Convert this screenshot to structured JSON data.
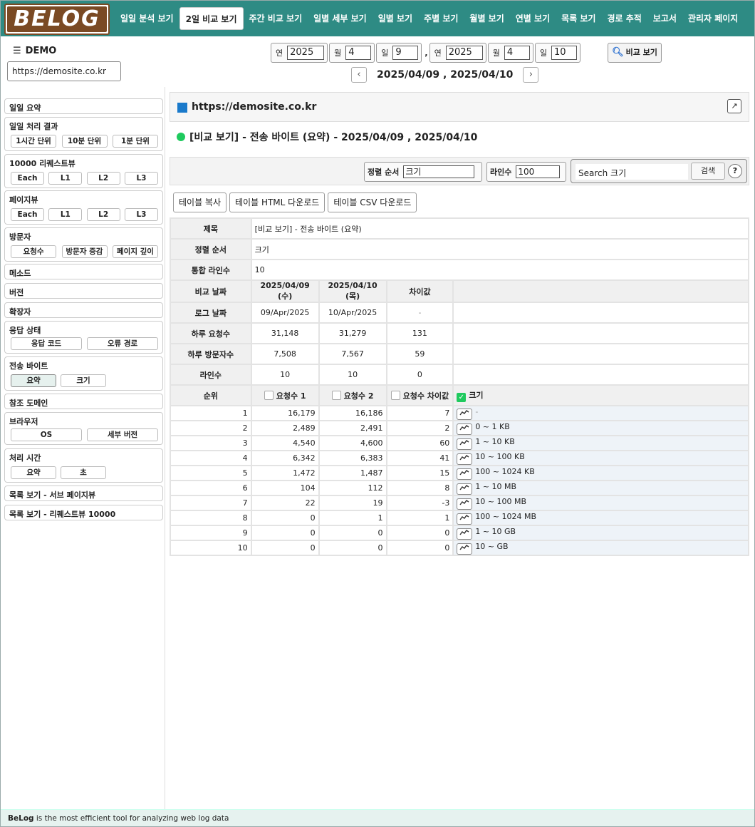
{
  "brand": {
    "logo_text": "BELOG"
  },
  "nav": [
    "일일 분석 보기",
    "2일 비교 보기",
    "주간 비교 보기",
    "일별 세부 보기",
    "일별 보기",
    "주별 보기",
    "월별 보기",
    "연별 보기",
    "목록 보기",
    "경로 추적",
    "보고서",
    "관리자 페이지"
  ],
  "header": {
    "site_name": "DEMO",
    "site_url": "https://demosite.co.kr",
    "date_labels": {
      "year": "연",
      "month": "월",
      "day": "일"
    },
    "date1": {
      "year": "2025",
      "month": "4",
      "day": "9"
    },
    "date2": {
      "year": "2025",
      "month": "4",
      "day": "10"
    },
    "compare_button": "비교 보기",
    "range_text": "2025/04/09 , 2025/04/10"
  },
  "sidebar": {
    "daily_summary": "일일 요약",
    "daily_process": {
      "title": "일일 처리 결과",
      "buttons": [
        "1시간 단위",
        "10분 단위",
        "1분 단위"
      ]
    },
    "requests": {
      "title": "10000 리퀘스트뷰",
      "buttons": [
        "Each",
        "L1",
        "L2",
        "L3"
      ]
    },
    "pageviews": {
      "title": "페이지뷰",
      "buttons": [
        "Each",
        "L1",
        "L2",
        "L3"
      ]
    },
    "visitors": {
      "title": "방문자",
      "buttons": [
        "요청수",
        "방문자 증감",
        "페이지 깊이"
      ]
    },
    "method": "메소드",
    "version": "버전",
    "extension": "확장자",
    "status": {
      "title": "응답 상태",
      "buttons": [
        "응답 코드",
        "오류 경로"
      ]
    },
    "bytes": {
      "title": "전송 바이트",
      "buttons": [
        "요약",
        "크기"
      ]
    },
    "referer": "참조 도메인",
    "browser": {
      "title": "브라우저",
      "buttons": [
        "OS",
        "세부 버전"
      ]
    },
    "ptime": {
      "title": "처리 시간",
      "buttons": [
        "요약",
        "초"
      ]
    },
    "list_sub": "목록 보기 - 서브 페이지뷰",
    "list_req": "목록 보기 - 리퀘스트뷰 10000"
  },
  "main": {
    "site_title": "https://demosite.co.kr",
    "report_title": "[비교 보기] - 전송 바이트 (요약) - 2025/04/09 , 2025/04/10",
    "sort_label": "정렬 순서",
    "sort_value": "크기",
    "lines_label": "라인수",
    "lines_value": "100",
    "search_placeholder": "Search 크기",
    "search_button": "검색",
    "help": "?",
    "actions": [
      "테이블 복사",
      "테이블 HTML 다운로드",
      "테이블 CSV 다운로드"
    ]
  },
  "table": {
    "meta": [
      {
        "label": "제목",
        "value": "[비교 보기] - 전송 바이트 (요약)"
      },
      {
        "label": "정렬 순서",
        "value": "크기"
      },
      {
        "label": "통합 라인수",
        "value": "10"
      }
    ],
    "compare_header": {
      "label": "비교 날짜",
      "d1": "2025/04/09 (수)",
      "d2": "2025/04/10 (목)",
      "diff": "차이값"
    },
    "compare_rows": [
      {
        "label": "로그 날짜",
        "d1": "09/Apr/2025",
        "d2": "10/Apr/2025",
        "diff": "-"
      },
      {
        "label": "하루 요청수",
        "d1": "31,148",
        "d2": "31,279",
        "diff": "131"
      },
      {
        "label": "하루 방문자수",
        "d1": "7,508",
        "d2": "7,567",
        "diff": "59"
      },
      {
        "label": "라인수",
        "d1": "10",
        "d2": "10",
        "diff": "0"
      }
    ],
    "columns": [
      "순위",
      "요청수 1",
      "요청수 2",
      "요청수 차이값",
      "크기"
    ],
    "rows": [
      {
        "rank": "1",
        "r1": "16,179",
        "r2": "16,186",
        "diff": "7",
        "size": "-"
      },
      {
        "rank": "2",
        "r1": "2,489",
        "r2": "2,491",
        "diff": "2",
        "size": "0 ~ 1 KB"
      },
      {
        "rank": "3",
        "r1": "4,540",
        "r2": "4,600",
        "diff": "60",
        "size": "1 ~ 10 KB"
      },
      {
        "rank": "4",
        "r1": "6,342",
        "r2": "6,383",
        "diff": "41",
        "size": "10 ~ 100 KB"
      },
      {
        "rank": "5",
        "r1": "1,472",
        "r2": "1,487",
        "diff": "15",
        "size": "100 ~ 1024 KB"
      },
      {
        "rank": "6",
        "r1": "104",
        "r2": "112",
        "diff": "8",
        "size": "1 ~ 10 MB"
      },
      {
        "rank": "7",
        "r1": "22",
        "r2": "19",
        "diff": "-3",
        "size": "10 ~ 100 MB"
      },
      {
        "rank": "8",
        "r1": "0",
        "r2": "1",
        "diff": "1",
        "size": "100 ~ 1024 MB"
      },
      {
        "rank": "9",
        "r1": "0",
        "r2": "0",
        "diff": "0",
        "size": "1 ~ 10 GB"
      },
      {
        "rank": "10",
        "r1": "0",
        "r2": "0",
        "diff": "0",
        "size": "10 ~ GB"
      }
    ]
  },
  "footer": {
    "brand": "BeLog",
    "text": " is the most efficient tool for analyzing web log data"
  }
}
